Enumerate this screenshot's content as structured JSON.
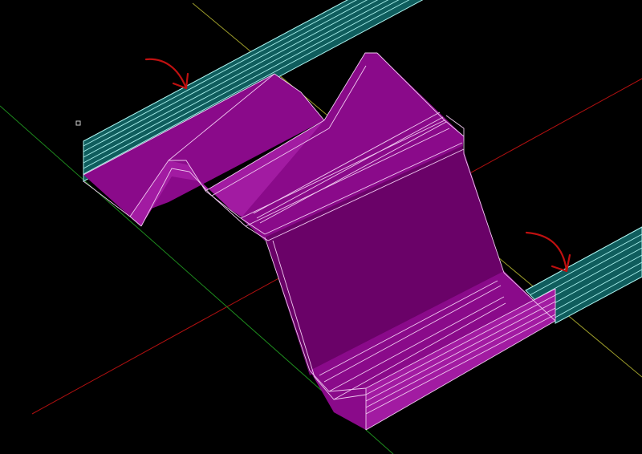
{
  "viewport": {
    "background_color": "#000000",
    "top_strip_color": "#5a5a5a"
  },
  "axes": {
    "x_axis_color": "#b01010",
    "y_axis_color": "#1e8c1e",
    "z_axis_color": "#9c9c2a"
  },
  "colors": {
    "part_face": "#8a0a8a",
    "part_face_light": "#a21ba2",
    "part_face_dark": "#6a0268",
    "part_edge": "#f0c8f0",
    "pcb_fill": "#0f5d5d",
    "pcb_edge": "#a8f0ec",
    "arrow": "#c01010",
    "pick_box": "#cfcfcf"
  },
  "icons": {
    "arrow_left": "red-curved-arrow-icon",
    "arrow_right": "red-curved-arrow-icon",
    "pick_box": "pick-box-icon"
  }
}
